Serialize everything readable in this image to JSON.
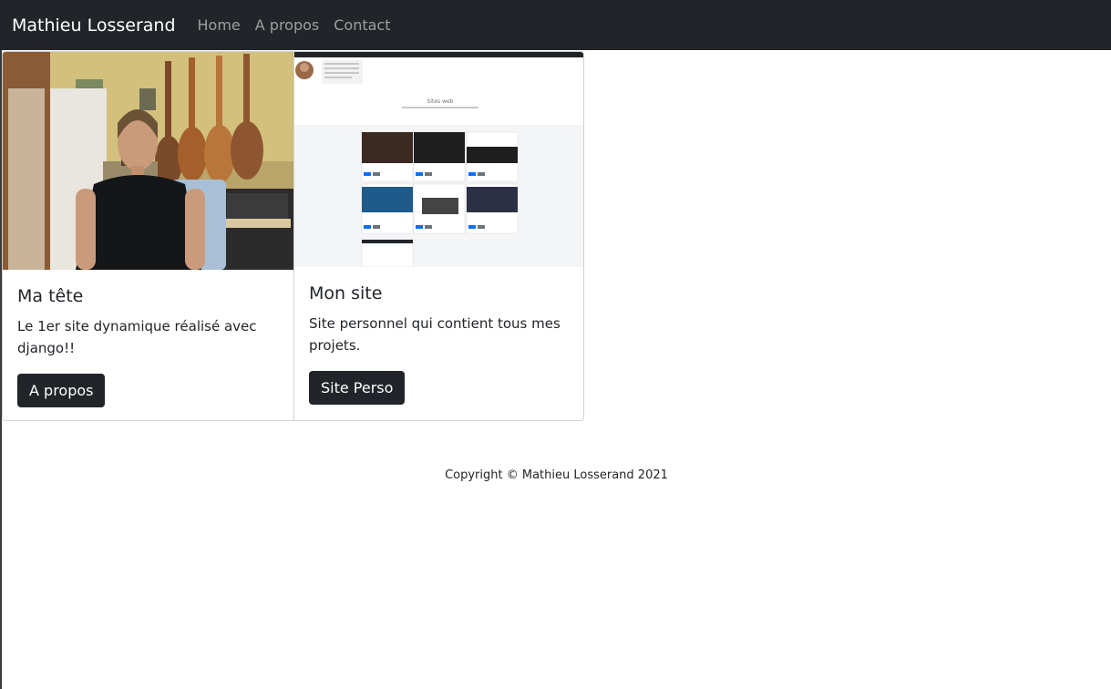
{
  "navbar": {
    "brand": "Mathieu Losserand",
    "links": [
      "Home",
      "A propos",
      "Contact"
    ]
  },
  "cards": [
    {
      "image": "portrait-photo",
      "title": "Ma tête",
      "text": "Le 1er site dynamique réalisé avec django!!",
      "button": "A propos"
    },
    {
      "image": "website-screenshot",
      "title": "Mon site",
      "text": "Site personnel qui contient tous mes projets.",
      "button": "Site Perso",
      "preview": {
        "heading": "Sites web"
      }
    }
  ],
  "footer": {
    "copyright": "Copyright © Mathieu Losserand 2021"
  },
  "colors": {
    "navbar_bg": "#212529",
    "button_bg": "#212529",
    "nav_link": "rgba(255,255,255,0.55)"
  }
}
